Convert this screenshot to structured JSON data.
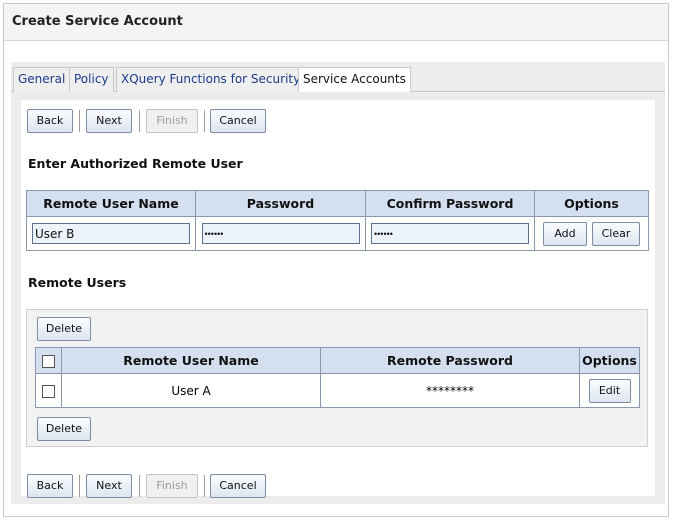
{
  "header": {
    "title": "Create Service Account"
  },
  "tabs": [
    {
      "label": "General"
    },
    {
      "label": "Policy"
    },
    {
      "label": "XQuery Functions for Security"
    },
    {
      "label": "Service Accounts"
    }
  ],
  "toolbar": {
    "back_label": "Back",
    "next_label": "Next",
    "finish_label": "Finish",
    "cancel_label": "Cancel"
  },
  "authorized_section": {
    "title": "Enter Authorized Remote User",
    "columns": [
      "Remote User Name",
      "Password",
      "Confirm Password",
      "Options"
    ],
    "user_name_value": "User B",
    "password_value": "••••••",
    "confirm_password_value": "••••••",
    "add_label": "Add",
    "clear_label": "Clear"
  },
  "remote_users": {
    "title": "Remote Users",
    "delete_label": "Delete",
    "columns": [
      "Remote User Name",
      "Remote Password",
      "Options"
    ],
    "rows": [
      {
        "name": "User A",
        "password": "********",
        "edit_label": "Edit"
      }
    ]
  }
}
